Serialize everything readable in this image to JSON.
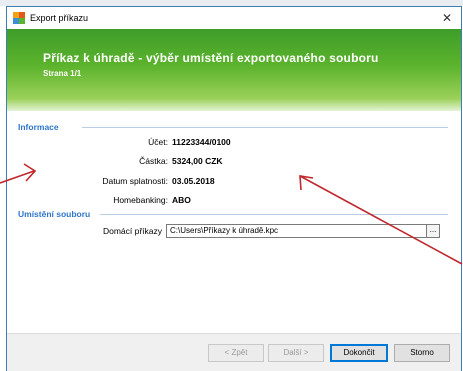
{
  "window": {
    "title": "Export příkazu",
    "close_label": "✕",
    "app_icon": "export-app-icon"
  },
  "banner": {
    "heading": "Příkaz k úhradě - výběr umístění exportovaného souboru",
    "page": "Strana 1/1"
  },
  "info": {
    "section_title": "Informace",
    "rows": [
      {
        "label": "Účet:",
        "value": "11223344/0100"
      },
      {
        "label": "Částka:",
        "value": "5324,00 CZK"
      },
      {
        "label": "Datum splatnosti:",
        "value": "03.05.2018"
      },
      {
        "label": "Homebanking:",
        "value": "ABO"
      }
    ]
  },
  "file_location": {
    "section_title": "Umístění souboru",
    "field_label": "Domácí příkazy",
    "field_value": "C:\\Users\\Příkazy k úhradě.kpc",
    "browse_label": "..."
  },
  "footer": {
    "back_label": "< Zpět",
    "next_label": "Další >",
    "finish_label": "Dokončit",
    "cancel_label": "Storno"
  },
  "annotation_color": "#c0282d"
}
